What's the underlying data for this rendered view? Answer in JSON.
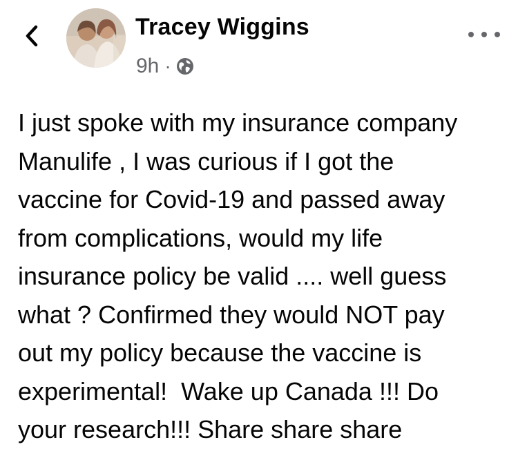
{
  "post": {
    "author_name": "Tracey Wiggins",
    "timestamp": "9h",
    "separator": "·",
    "audience_icon": "globe-icon",
    "text_lines": [
      "I just spoke with my insurance company",
      "Manulife , I was curious if I got the",
      "vaccine for Covid-19 and passed away",
      "from complications, would my life",
      "insurance policy be valid .... well guess",
      "what ? Confirmed they would NOT pay",
      "out my policy because the vaccine is",
      "experimental!  Wake up Canada !!! Do",
      "your research!!! Share share share"
    ]
  },
  "icons": {
    "back": "back-chevron-icon",
    "more": "more-options-icon"
  },
  "colors": {
    "text_primary": "#050505",
    "text_secondary": "#65676b",
    "background": "#ffffff"
  }
}
